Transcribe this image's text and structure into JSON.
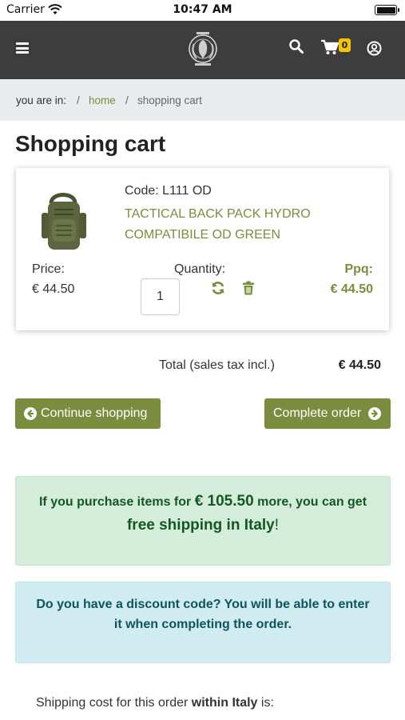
{
  "status_bar": {
    "carrier": "Carrier",
    "time": "10:47 AM"
  },
  "header": {
    "cart_count": "0",
    "icons": [
      "hamburger-menu-icon",
      "logo",
      "search-icon",
      "shopping-cart-icon",
      "user-account-icon"
    ]
  },
  "breadcrumb": {
    "label": "you are in:",
    "separator": "/",
    "home": "home",
    "current": "shopping cart"
  },
  "page": {
    "title": "Shopping cart"
  },
  "cart_item": {
    "code_label": "Code:",
    "code": "L111 OD",
    "name_line1": "TACTICAL BACK PACK HYDRO",
    "name_line2": "COMPATIBILE OD GREEN",
    "price_label": "Price:",
    "price": "€ 44.50",
    "quantity_label": "Quantity:",
    "quantity": "1",
    "ppq_label": "Ppq:",
    "ppq": "€ 44.50"
  },
  "totals": {
    "label": "Total (sales tax incl.)",
    "value": "€ 44.50"
  },
  "buttons": {
    "continue": "Continue shopping",
    "complete": "Complete order"
  },
  "free_shipping_alert": {
    "prefix": "If you purchase items for",
    "amount": "€ 105.50",
    "suffix": "more, you can get",
    "line2": "free shipping in Italy",
    "bang": "!"
  },
  "discount_alert": {
    "line1": "Do you have a discount code? You will be able to enter",
    "line2": "it when completing the order."
  },
  "shipping_note": {
    "prefix": "Shipping cost for this order",
    "bold": "within Italy",
    "suffix": "is:"
  },
  "colors": {
    "accent": "#7a8d3e",
    "topbar": "#3d3d3d",
    "badge": "#f2c500",
    "success_bg": "#d4edda",
    "info_bg": "#d1ecf1"
  }
}
